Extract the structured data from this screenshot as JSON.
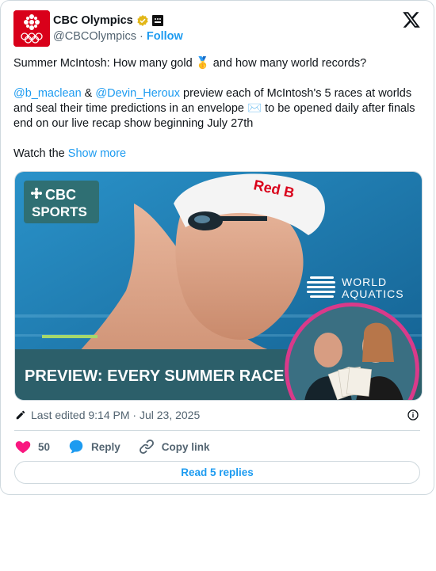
{
  "author": {
    "name": "CBC Olympics",
    "handle": "@CBCOlympics",
    "separator": "·",
    "follow_label": "Follow"
  },
  "tweet": {
    "line1_text": "Summer McIntosh: How many gold ",
    "line1_emoji": "🥇",
    "line1_tail": " and how many world records?",
    "mention1": "@b_maclean",
    "amp": " & ",
    "mention2": "@Devin_Heroux",
    "para2_text": " preview each of McIntosh's 5 races at worlds and seal their time predictions in an envelope ",
    "para2_emoji": "✉️",
    "para2_tail": " to be opened daily after finals end on our live recap show beginning July 27th",
    "watch_text": "Watch the ",
    "show_more_label": "Show more"
  },
  "media": {
    "cbc_line1": "CBC",
    "cbc_line2": "SPORTS",
    "swim_cap_text": "Red B",
    "wa_line1": "WORLD",
    "wa_line2": "AQUATICS",
    "preview_title": "PREVIEW: EVERY SUMMER RACE",
    "colors": {
      "pool": "#1e7fb6",
      "banner": "#2c5f6a",
      "accent": "#a6d86b",
      "magenta": "#d93a8a"
    }
  },
  "meta": {
    "edited_text": "Last edited 9:14 PM · Jul 23, 2025"
  },
  "actions": {
    "like_count": "50",
    "reply_label": "Reply",
    "copy_label": "Copy link",
    "read_replies_label": "Read 5 replies"
  },
  "colors": {
    "link": "#1d9bf0",
    "like": "#f91880",
    "cbc_red": "#d9001a"
  }
}
